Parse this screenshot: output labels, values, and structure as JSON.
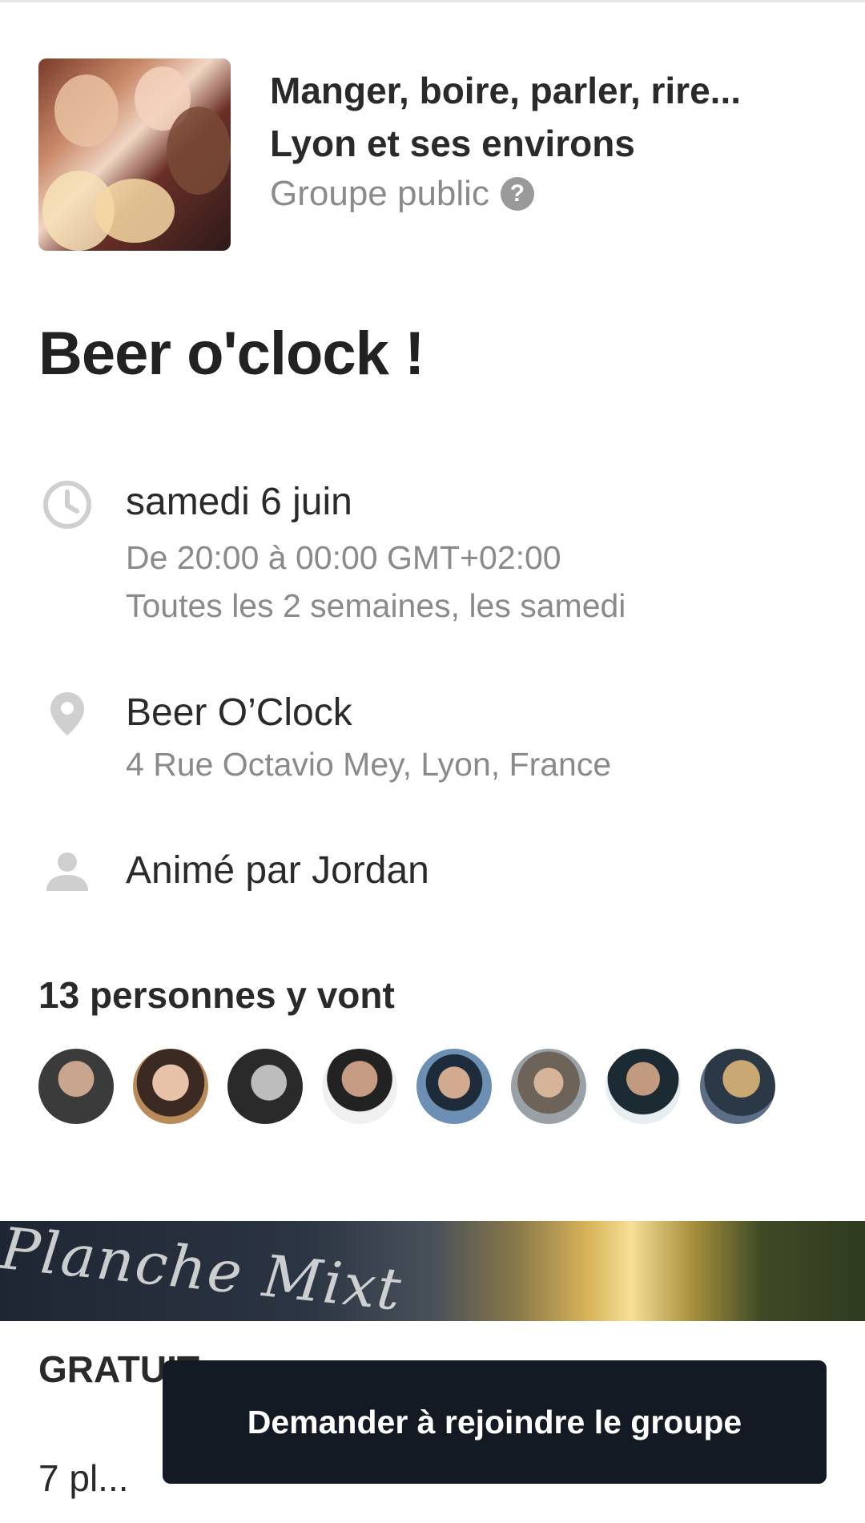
{
  "group": {
    "name": "Manger, boire, parler, rire... Lyon et ses environs",
    "type": "Groupe public",
    "help_glyph": "?"
  },
  "event": {
    "title": "Beer o'clock !",
    "date": "samedi 6 juin",
    "time": "De 20:00 à 00:00 GMT+02:00",
    "recurrence": "Toutes les 2 semaines, les samedi",
    "venue": "Beer O’Clock",
    "address": "4 Rue Octavio Mey, Lyon, France",
    "host": "Animé par Jordan"
  },
  "attendees": {
    "title": "13 personnes y vont",
    "avatar_count_shown": 8
  },
  "banner": {
    "text": "Planche Mixt"
  },
  "footer": {
    "price": "GRATUIT",
    "spots": "7 pl...",
    "join_label": "Demander à rejoindre le groupe"
  },
  "icons": {
    "time": "clock-icon",
    "location": "map-pin-icon",
    "host": "person-icon",
    "help": "help-icon"
  },
  "colors": {
    "button_bg": "#131a24",
    "muted_text": "#8a8a8a",
    "icon_gray": "#cfcfcf"
  }
}
